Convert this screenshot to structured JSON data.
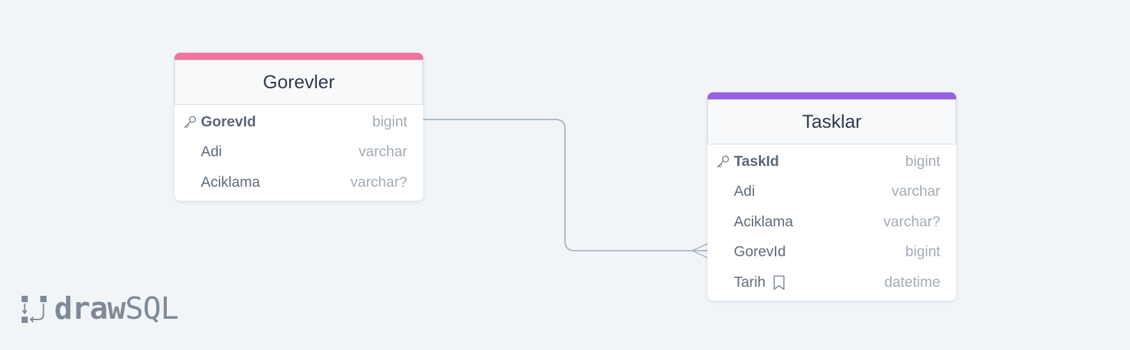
{
  "tables": [
    {
      "name": "Gorevler",
      "accent": "#f1729c",
      "columns": [
        {
          "name": "GorevId",
          "type": "bigint",
          "primary_key": true
        },
        {
          "name": "Adi",
          "type": "varchar"
        },
        {
          "name": "Aciklama",
          "type": "varchar?"
        }
      ]
    },
    {
      "name": "Tasklar",
      "accent": "#9661e0",
      "columns": [
        {
          "name": "TaskId",
          "type": "bigint",
          "primary_key": true
        },
        {
          "name": "Adi",
          "type": "varchar"
        },
        {
          "name": "Aciklama",
          "type": "varchar?"
        },
        {
          "name": "GorevId",
          "type": "bigint"
        },
        {
          "name": "Tarih",
          "type": "datetime",
          "note_icon": "bookmark-icon"
        }
      ]
    }
  ],
  "relationship": {
    "from": "Gorevler.GorevId",
    "to": "Tasklar.GorevId",
    "type": "one-to-many",
    "color": "#a1afc0"
  },
  "logo": {
    "bold_text": "draw",
    "light_text": "SQL",
    "color": "#7e8a97"
  }
}
